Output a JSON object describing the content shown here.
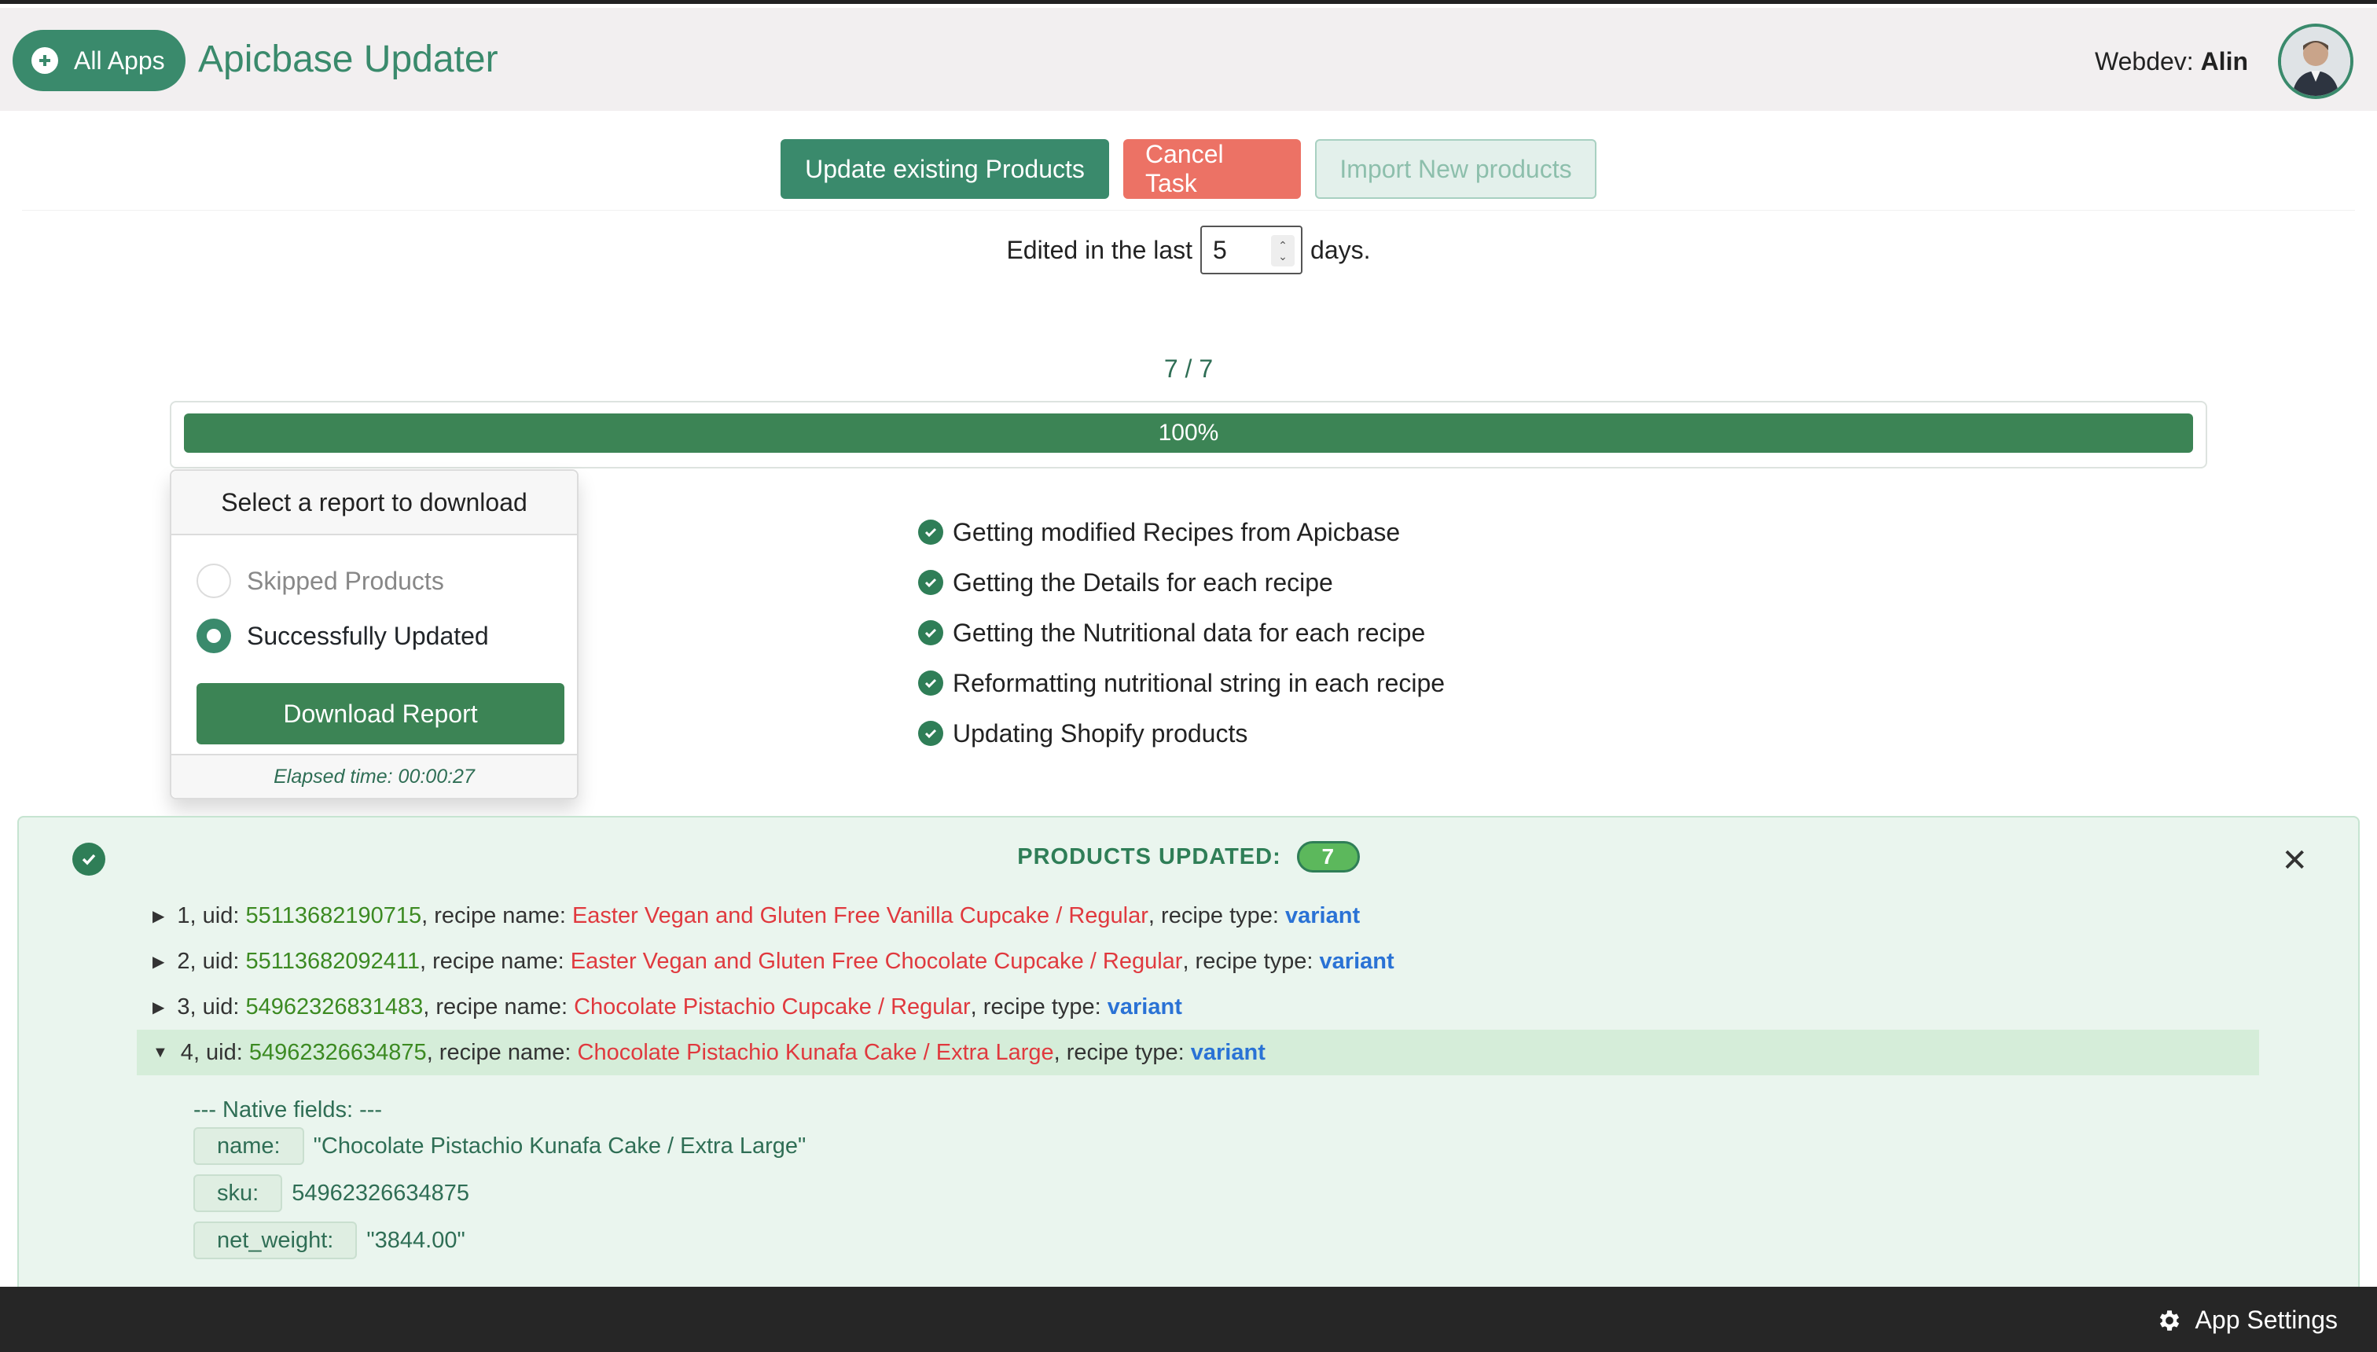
{
  "header": {
    "all_apps_label": "All Apps",
    "title": "Apicbase Updater",
    "user_prefix": "Webdev:",
    "user_name": "Alin"
  },
  "toolbar": {
    "update_label": "Update existing Products",
    "cancel_label": "Cancel Task",
    "import_label": "Import New products"
  },
  "filter": {
    "prefix": "Edited in the last",
    "days_value": "5",
    "suffix": "days."
  },
  "progress": {
    "counter": "7 / 7",
    "percent_label": "100%",
    "fraction": 1.0
  },
  "report": {
    "heading": "Select a report to download",
    "options": [
      {
        "label": "Skipped Products",
        "checked": false
      },
      {
        "label": "Successfully Updated",
        "checked": true
      }
    ],
    "download_label": "Download Report",
    "elapsed": "Elapsed time: 00:00:27"
  },
  "steps": [
    "Getting modified Recipes from Apicbase",
    "Getting the Details for each recipe",
    "Getting the Nutritional data for each recipe",
    "Reformatting nutritional string in each recipe",
    "Updating Shopify products"
  ],
  "products": {
    "title": "PRODUCTS UPDATED:",
    "count": "7",
    "rows": [
      {
        "index": "1",
        "uid": "55113682190715",
        "name": "Easter Vegan and Gluten Free Vanilla Cupcake / Regular",
        "type": "variant"
      },
      {
        "index": "2",
        "uid": "55113682092411",
        "name": "Easter Vegan and Gluten Free Chocolate Cupcake / Regular",
        "type": "variant"
      },
      {
        "index": "3",
        "uid": "54962326831483",
        "name": "Chocolate Pistachio Cupcake / Regular",
        "type": "variant"
      },
      {
        "index": "4",
        "uid": "54962326634875",
        "name": "Chocolate Pistachio Kunafa Cake / Extra Large",
        "type": "variant"
      }
    ],
    "native_heading": "--- Native fields: ---",
    "fields": [
      {
        "key": "name:",
        "value": "\"Chocolate Pistachio Kunafa Cake / Extra Large\""
      },
      {
        "key": "sku:",
        "value": "54962326634875"
      },
      {
        "key": "net_weight:",
        "value": "\"3844.00\""
      }
    ]
  },
  "footer": {
    "settings_label": "App Settings"
  },
  "colors": {
    "brand": "#3a8a6c",
    "danger": "#ec7265",
    "progress": "#3c8455"
  }
}
